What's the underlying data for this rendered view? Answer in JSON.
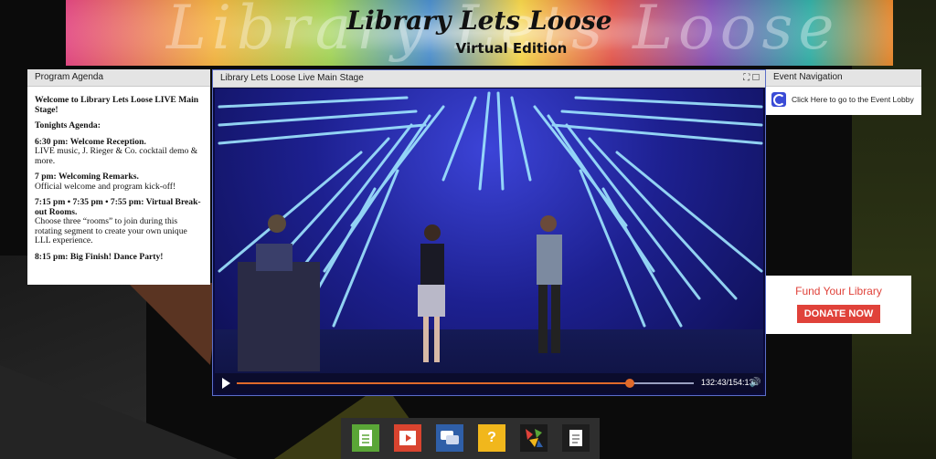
{
  "banner": {
    "title": "Library Lets Loose",
    "subtitle": "Virtual Edition"
  },
  "agenda": {
    "title": "Program Agenda",
    "intro": "Welcome to Library Lets Loose LIVE Main Stage!",
    "heading": "Tonights Agenda:",
    "items": [
      {
        "time": "6:30 pm: Welcome Reception.",
        "desc": "LIVE music, J. Rieger & Co. cocktail demo & more."
      },
      {
        "time": "7 pm: Welcoming Remarks.",
        "desc": "Official welcome and program kick-off!"
      },
      {
        "time": "7:15 pm • 7:35 pm • 7:55 pm: Virtual Break-out Rooms.",
        "desc": "Choose three “rooms” to join during this rotating segment to create your own unique LLL experience."
      },
      {
        "time": "8:15 pm: Big Finish! Dance Party!",
        "desc": ""
      }
    ]
  },
  "stage": {
    "title": "Library Lets Loose Live Main Stage",
    "time_display": "132:43/154:13",
    "progress": 0.8606
  },
  "nav": {
    "title": "Event Navigation",
    "link": "Click Here to go to the Event Lobby"
  },
  "fund": {
    "title": "Fund Your Library",
    "button": "DONATE NOW"
  },
  "toolbar": {
    "items": [
      {
        "icon": "document-icon",
        "color": "#5aa637"
      },
      {
        "icon": "video-icon",
        "color": "#d9442f"
      },
      {
        "icon": "chat-icon",
        "color": "#2f5fa8"
      },
      {
        "icon": "question-icon",
        "color": "#f1b71c"
      },
      {
        "icon": "mosaic-icon",
        "color": "#1a1a1a"
      },
      {
        "icon": "page-icon",
        "color": "#1e1e1e"
      }
    ]
  }
}
